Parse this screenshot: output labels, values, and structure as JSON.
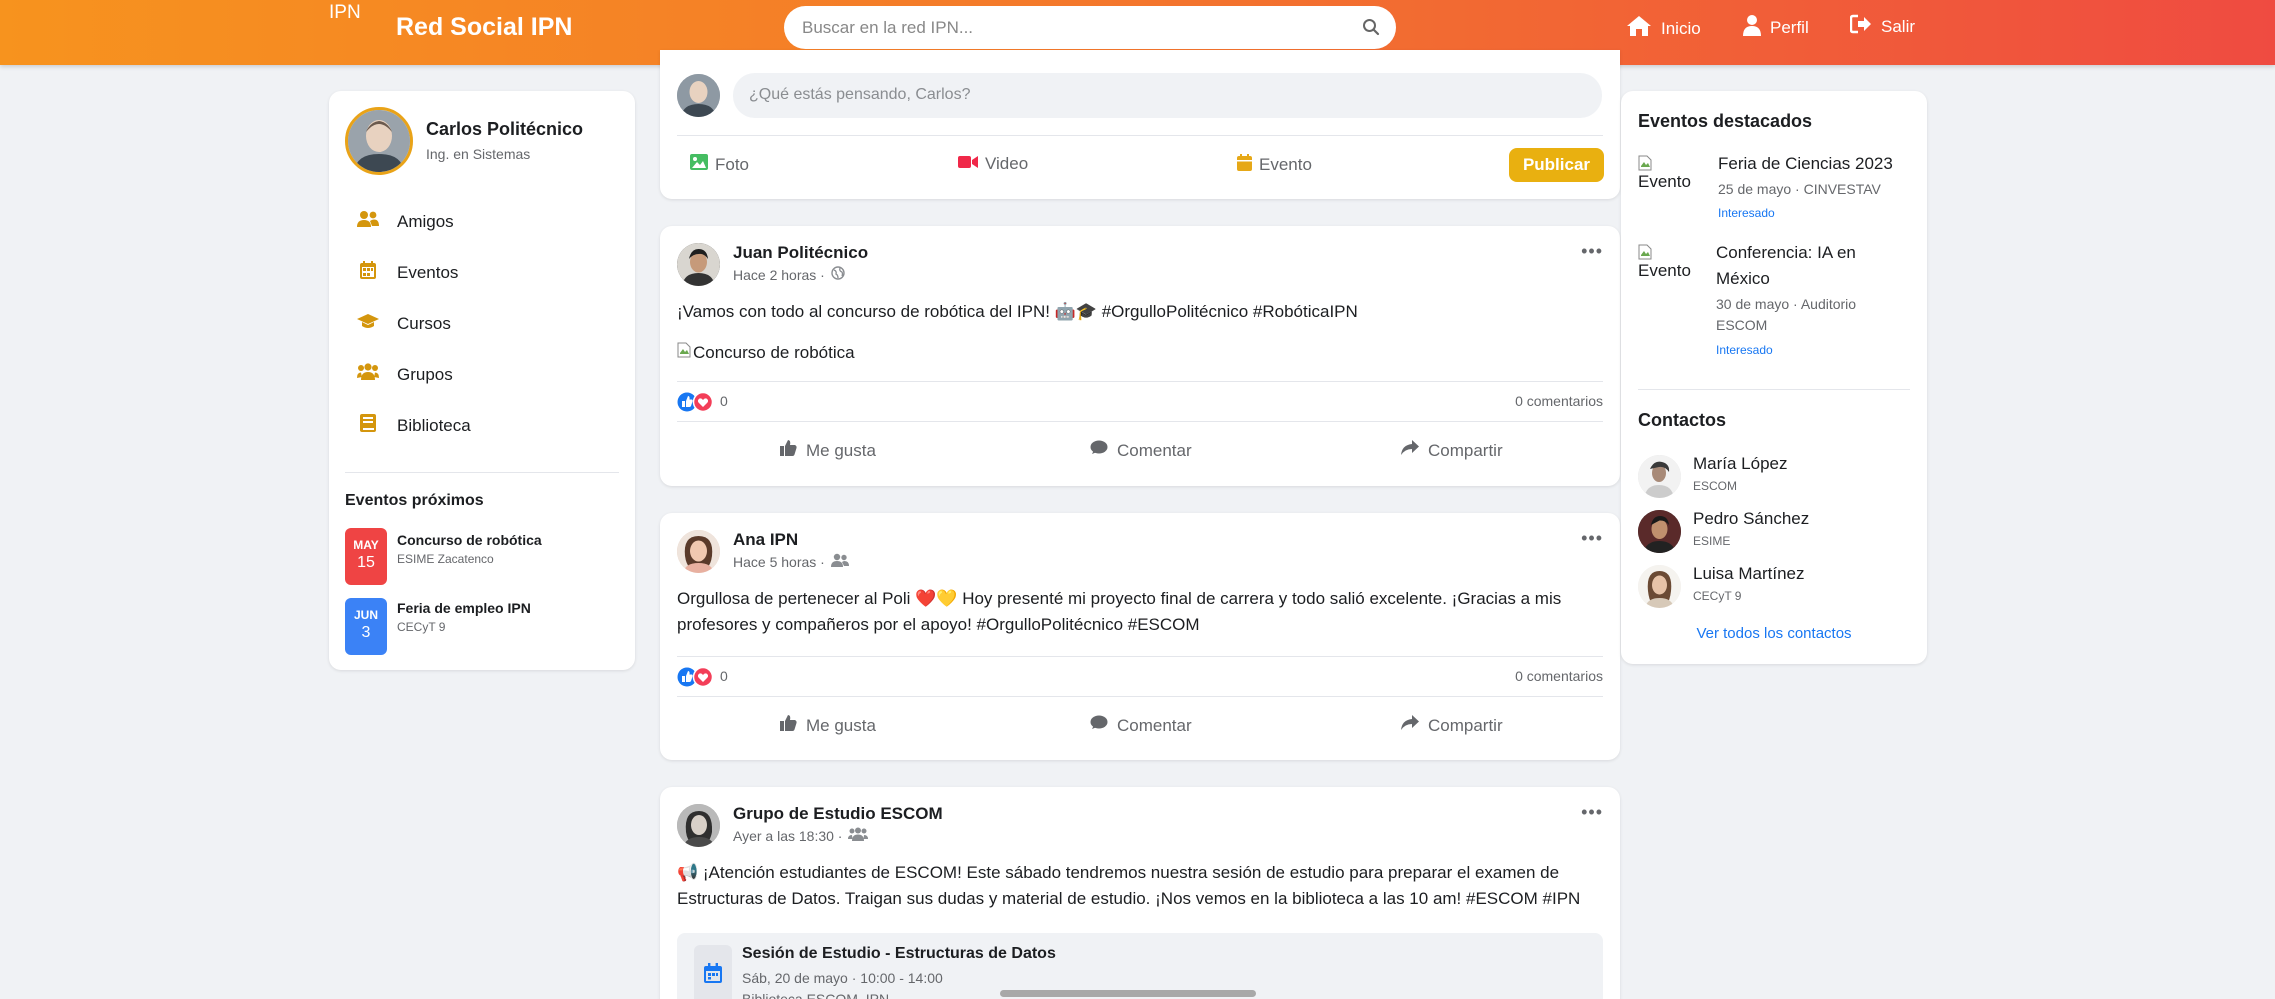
{
  "header": {
    "logo_alt": "IPN",
    "brand": "Red Social IPN",
    "search_placeholder": "Buscar en la red IPN...",
    "nav": {
      "home": "Inicio",
      "profile": "Perfil",
      "logout": "Salir"
    },
    "colors": {
      "gradient_start": "#f7931e",
      "gradient_end": "#ef4b41"
    }
  },
  "profile": {
    "name": "Carlos Politécnico",
    "subtitle": "Ing. en Sistemas"
  },
  "sidebar": {
    "items": [
      {
        "label": "Amigos",
        "icon": "users-icon"
      },
      {
        "label": "Eventos",
        "icon": "calendar-icon"
      },
      {
        "label": "Cursos",
        "icon": "graduation-cap-icon"
      },
      {
        "label": "Grupos",
        "icon": "group-icon"
      },
      {
        "label": "Biblioteca",
        "icon": "book-icon"
      }
    ],
    "upcoming_title": "Eventos próximos",
    "upcoming": [
      {
        "month": "MAY",
        "day": "15",
        "title": "Concurso de robótica",
        "place": "ESIME Zacatenco",
        "color": "#ef4444"
      },
      {
        "month": "JUN",
        "day": "3",
        "title": "Feria de empleo IPN",
        "place": "CECyT 9",
        "color": "#3b82f6"
      }
    ]
  },
  "composer": {
    "placeholder": "¿Qué estás pensando, Carlos?",
    "photo": "Foto",
    "video": "Video",
    "event": "Evento",
    "publish": "Publicar"
  },
  "posts": [
    {
      "author": "Juan Politécnico",
      "time": "Hace 2 horas ·",
      "text": "¡Vamos con todo al concurso de robótica del IPN! 🤖🎓 #OrgulloPolitécnico #RobóticaIPN",
      "image_alt": "Concurso de robótica",
      "likes": "0",
      "comments": "0 comentarios"
    },
    {
      "author": "Ana IPN",
      "time": "Hace 5 horas ·",
      "text_line1": "Orgullosa de pertenecer al Poli ❤️💛 Hoy presenté mi proyecto final de carrera y todo salió excelente. ¡Gracias a mis",
      "text_line2": "profesores y compañeros por el apoyo! #OrgulloPolitécnico #ESCOM",
      "likes": "0",
      "comments": "0 comentarios"
    },
    {
      "author": "Grupo de Estudio ESCOM",
      "time": "Ayer a las 18:30 ·",
      "text_line1": "📢 ¡Atención estudiantes de ESCOM! Este sábado tendremos nuestra sesión de estudio para preparar el examen de",
      "text_line2": "Estructuras de Datos. Traigan sus dudas y material de estudio. ¡Nos vemos en la biblioteca a las 10 am! #ESCOM #IPN",
      "event_title": "Sesión de Estudio - Estructuras de Datos",
      "event_when": "Sáb, 20 de mayo · 10:00 - 14:00",
      "event_where": "Biblioteca ESCOM, IPN"
    }
  ],
  "post_actions": {
    "like": "Me gusta",
    "comment": "Comentar",
    "share": "Compartir"
  },
  "right": {
    "featured_title": "Eventos destacados",
    "events": [
      {
        "img_alt": "Evento",
        "title": "Feria de Ciencias 2023",
        "sub": "25 de mayo · CINVESTAV",
        "tag": "Interesado"
      },
      {
        "img_alt": "Evento",
        "title_line1": "Conferencia: IA en",
        "title_line2": "México",
        "sub_line1": "30 de mayo · Auditorio",
        "sub_line2": "ESCOM",
        "tag": "Interesado"
      }
    ],
    "contacts_title": "Contactos",
    "contacts": [
      {
        "name": "María López",
        "school": "ESCOM"
      },
      {
        "name": "Pedro Sánchez",
        "school": "ESIME"
      },
      {
        "name": "Luisa Martínez",
        "school": "CECyT 9"
      }
    ],
    "see_all": "Ver todos los contactos"
  }
}
